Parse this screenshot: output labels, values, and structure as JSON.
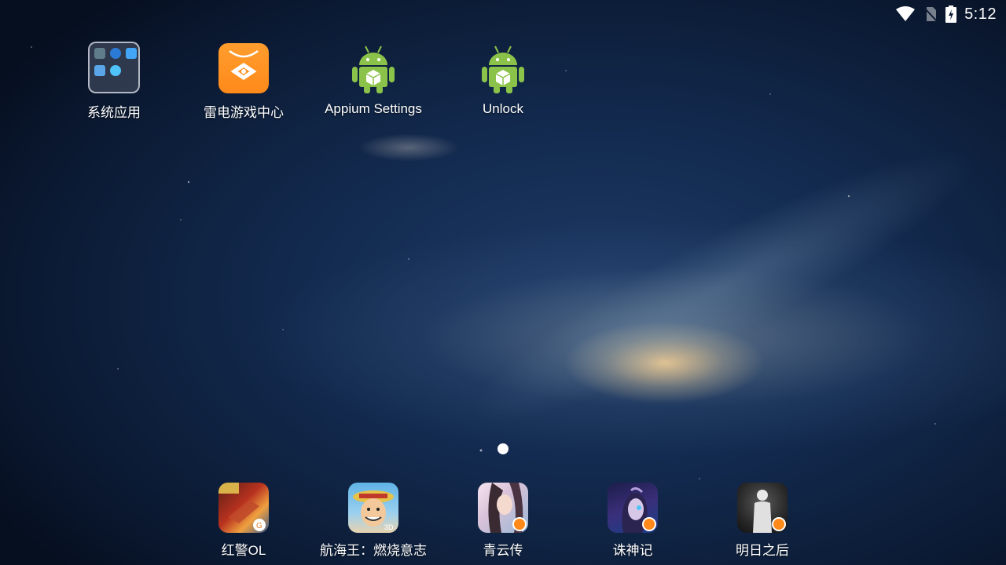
{
  "status_bar": {
    "time": "5:12",
    "icons": [
      "wifi-icon",
      "no-sim-icon",
      "battery-charging-icon"
    ]
  },
  "home": {
    "shortcuts": [
      {
        "label": "系统应用",
        "icon": "folder-icon"
      },
      {
        "label": "雷电游戏中心",
        "icon": "game-center-icon"
      },
      {
        "label": "Appium Settings",
        "icon": "android-icon"
      },
      {
        "label": "Unlock",
        "icon": "android-icon"
      }
    ],
    "page_indicator": {
      "current": 1,
      "total": 1
    }
  },
  "dock": {
    "apps": [
      {
        "label": "红警OL",
        "icon": "game-icon"
      },
      {
        "label": "航海王：燃烧意志",
        "icon": "game-icon"
      },
      {
        "label": "青云传",
        "icon": "game-icon"
      },
      {
        "label": "诛神记",
        "icon": "game-icon"
      },
      {
        "label": "明日之后",
        "icon": "game-icon"
      }
    ]
  },
  "colors": {
    "accent_orange": "#ff8a1a",
    "android_green": "#8bc34a",
    "wallpaper_dark": "#0b1a33"
  }
}
